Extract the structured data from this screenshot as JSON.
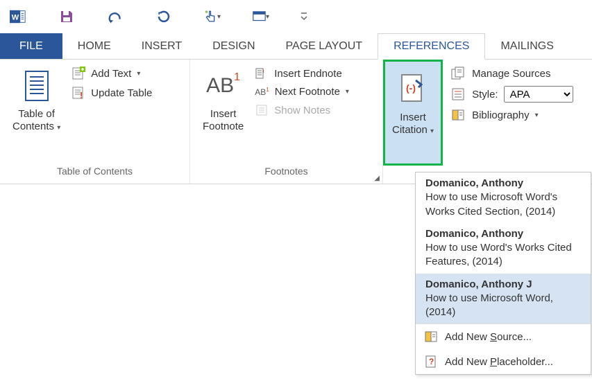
{
  "tabs": {
    "file": "FILE",
    "home": "HOME",
    "insert": "INSERT",
    "design": "DESIGN",
    "pagelayout": "PAGE LAYOUT",
    "references": "REFERENCES",
    "mailings": "MAILINGS"
  },
  "ribbon": {
    "toc": {
      "label": "Table of Contents",
      "button_line1": "Table of",
      "button_line2": "Contents",
      "add_text": "Add Text",
      "update_table": "Update Table"
    },
    "footnotes": {
      "label": "Footnotes",
      "insert_line1": "Insert",
      "insert_line2": "Footnote",
      "ab": "AB",
      "ab_sup": "1",
      "insert_endnote": "Insert Endnote",
      "next_footnote": "Next Footnote",
      "next_prefix": "AB",
      "next_sup": "1",
      "show_notes": "Show Notes"
    },
    "citations": {
      "insert_line1": "Insert",
      "insert_line2": "Citation",
      "manage_sources": "Manage Sources",
      "style_label": "Style:",
      "style_value": "APA",
      "bibliography": "Bibliography"
    }
  },
  "dropdown": {
    "sources": [
      {
        "author": "Domanico, Anthony",
        "title": "How to use Microsoft Word's Works Cited Section, (2014)"
      },
      {
        "author": "Domanico, Anthony",
        "title": "How to use Word's Works Cited Features, (2014)"
      },
      {
        "author": "Domanico, Anthony J",
        "title": "How to use Microsoft Word, (2014)"
      }
    ],
    "add_source_pre": "Add New ",
    "add_source_u": "S",
    "add_source_post": "ource...",
    "add_placeholder_pre": "Add New ",
    "add_placeholder_u": "P",
    "add_placeholder_post": "laceholder..."
  }
}
